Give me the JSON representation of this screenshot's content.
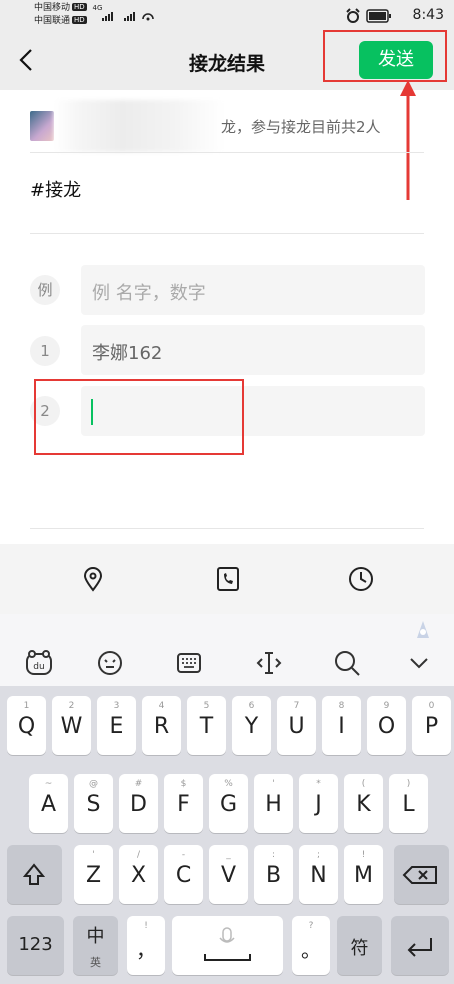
{
  "status_bar": {
    "carrier1": "中国移动",
    "carrier2": "中国联通",
    "hd": "HD",
    "net": "4G",
    "time": "8:43"
  },
  "nav": {
    "title": "接龙结果",
    "send_label": "发送"
  },
  "info": {
    "text": "龙，参与接龙目前共2人"
  },
  "tag": "#接龙",
  "rows": [
    {
      "num": "例",
      "text": "例 名字，数字"
    },
    {
      "num": "1",
      "text": "李娜162"
    },
    {
      "num": "2",
      "text": ""
    }
  ],
  "keyboard": {
    "row1": [
      [
        "1",
        "Q"
      ],
      [
        "2",
        "W"
      ],
      [
        "3",
        "E"
      ],
      [
        "4",
        "R"
      ],
      [
        "5",
        "T"
      ],
      [
        "6",
        "Y"
      ],
      [
        "7",
        "U"
      ],
      [
        "8",
        "I"
      ],
      [
        "9",
        "O"
      ],
      [
        "0",
        "P"
      ]
    ],
    "row2": [
      [
        "~",
        "A"
      ],
      [
        "@",
        "S"
      ],
      [
        "#",
        "D"
      ],
      [
        "$",
        "F"
      ],
      [
        "%",
        "G"
      ],
      [
        "'",
        "H"
      ],
      [
        "*",
        "J"
      ],
      [
        "(",
        "K"
      ],
      [
        ")",
        "L"
      ]
    ],
    "row3": [
      [
        "'",
        "Z"
      ],
      [
        "/",
        "X"
      ],
      [
        "-",
        "C"
      ],
      [
        "_",
        "V"
      ],
      [
        ":",
        "B"
      ],
      [
        ";",
        "N"
      ],
      [
        "!",
        "M"
      ]
    ],
    "num_key": "123",
    "lang_key": "中",
    "lang_sub": "英",
    "comma_sub": "!",
    "comma": "，",
    "period_sub": "?",
    "period": "。",
    "fu_key": "符"
  },
  "colors": {
    "accent": "#07c160",
    "annotation": "#e53935"
  }
}
